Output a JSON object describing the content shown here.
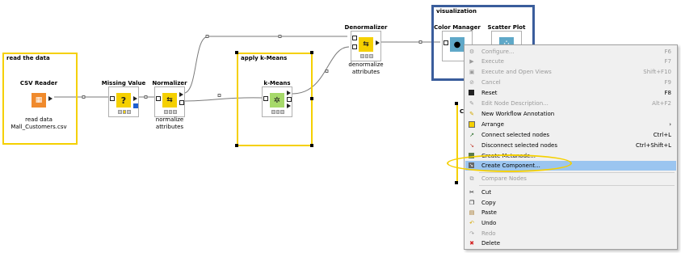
{
  "annotations": {
    "read_data": {
      "title": "read the data",
      "border": "#f5d000"
    },
    "kmeans": {
      "title": "apply k-Means",
      "border": "#f5d000"
    },
    "visualization": {
      "title": "visualization",
      "border": "#3a5d9c"
    }
  },
  "nodes": {
    "csv_reader": {
      "title": "CSV Reader",
      "label_line1": "read data",
      "label_line2": "Mall_Customers.csv",
      "icon": "table-import-icon",
      "color": "#f08a2c"
    },
    "missing_value": {
      "title": "Missing Value",
      "icon": "question-icon",
      "color": "#f5d000"
    },
    "normalizer": {
      "title": "Normalizer",
      "label_line1": "normalize",
      "label_line2": "attributes",
      "icon": "scale-icon",
      "color": "#f5d000"
    },
    "kmeans": {
      "title": "k-Means",
      "icon": "cluster-icon",
      "color": "#a6d96a"
    },
    "denormalizer": {
      "title": "Denormalizer",
      "label_line1": "denormalize",
      "label_line2": "attributes",
      "icon": "scale-icon",
      "color": "#f5d000"
    },
    "color_manager": {
      "title": "Color Manager",
      "icon": "color-drop-icon",
      "color": "#5fa8c8"
    },
    "scatter_plot": {
      "title": "Scatter Plot",
      "icon": "scatter-icon",
      "color": "#5fa8c8"
    }
  },
  "partial_node_label": "C",
  "context_menu": {
    "items": [
      {
        "label": "Configure...",
        "shortcut": "F6",
        "icon": "configure-icon",
        "disabled": true
      },
      {
        "label": "Execute",
        "shortcut": "F7",
        "icon": "execute-icon",
        "disabled": true
      },
      {
        "label": "Execute and Open Views",
        "shortcut": "Shift+F10",
        "icon": "execute-open-icon",
        "disabled": true
      },
      {
        "label": "Cancel",
        "shortcut": "F9",
        "icon": "cancel-icon",
        "disabled": true
      },
      {
        "label": "Reset",
        "shortcut": "F8",
        "icon": "reset-icon",
        "disabled": false
      },
      {
        "label": "Edit Node Description...",
        "shortcut": "Alt+F2",
        "icon": "edit-description-icon",
        "disabled": true
      },
      {
        "label": "New Workflow Annotation",
        "shortcut": "",
        "icon": "annotation-icon",
        "disabled": false
      },
      {
        "label": "Arrange",
        "shortcut": "›",
        "icon": "arrange-icon",
        "disabled": false
      },
      {
        "label": "Connect selected nodes",
        "shortcut": "Ctrl+L",
        "icon": "connect-icon",
        "disabled": false
      },
      {
        "label": "Disconnect selected nodes",
        "shortcut": "Ctrl+Shift+L",
        "icon": "disconnect-icon",
        "disabled": false
      },
      {
        "label": "Create Metanode...",
        "shortcut": "",
        "icon": "metanode-icon",
        "disabled": false
      },
      {
        "label": "Create Component...",
        "shortcut": "",
        "icon": "component-icon",
        "disabled": false,
        "highlight": true
      },
      {
        "label": "Compare Nodes",
        "shortcut": "",
        "icon": "compare-icon",
        "disabled": true
      },
      {
        "label": "Cut",
        "shortcut": "",
        "icon": "cut-icon",
        "disabled": false
      },
      {
        "label": "Copy",
        "shortcut": "",
        "icon": "copy-icon",
        "disabled": false
      },
      {
        "label": "Paste",
        "shortcut": "",
        "icon": "paste-icon",
        "disabled": false
      },
      {
        "label": "Undo",
        "shortcut": "",
        "icon": "undo-icon",
        "disabled": false
      },
      {
        "label": "Redo",
        "shortcut": "",
        "icon": "redo-icon",
        "disabled": true
      },
      {
        "label": "Delete",
        "shortcut": "",
        "icon": "delete-icon",
        "disabled": false
      }
    ]
  },
  "colors": {
    "highlight": "#9bc5f0",
    "callout": "#f5d000",
    "selection": "#3a5d9c"
  }
}
